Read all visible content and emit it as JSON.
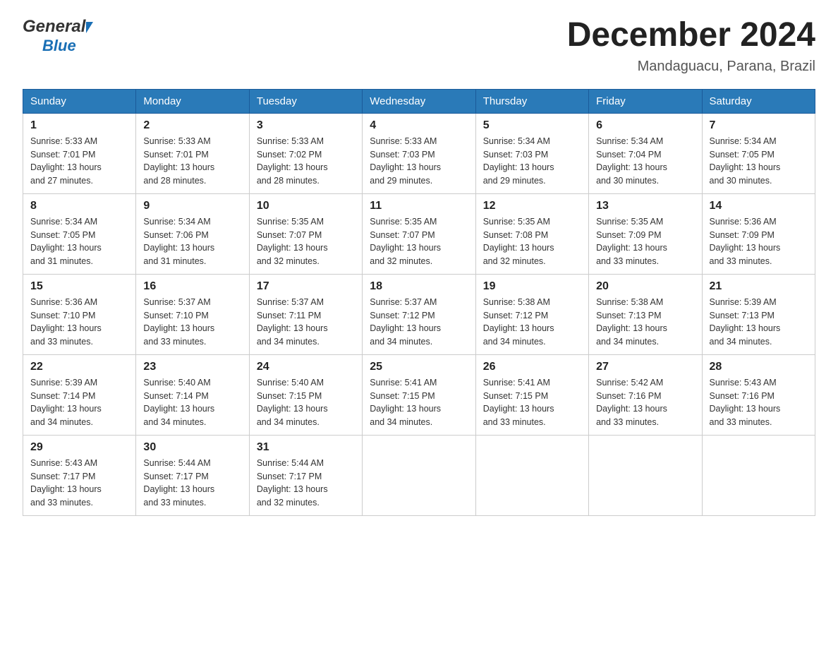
{
  "header": {
    "logo_general": "General",
    "logo_blue": "Blue",
    "month_title": "December 2024",
    "location": "Mandaguacu, Parana, Brazil"
  },
  "days_of_week": [
    "Sunday",
    "Monday",
    "Tuesday",
    "Wednesday",
    "Thursday",
    "Friday",
    "Saturday"
  ],
  "weeks": [
    [
      {
        "day": "1",
        "sunrise": "5:33 AM",
        "sunset": "7:01 PM",
        "daylight": "13 hours and 27 minutes."
      },
      {
        "day": "2",
        "sunrise": "5:33 AM",
        "sunset": "7:01 PM",
        "daylight": "13 hours and 28 minutes."
      },
      {
        "day": "3",
        "sunrise": "5:33 AM",
        "sunset": "7:02 PM",
        "daylight": "13 hours and 28 minutes."
      },
      {
        "day": "4",
        "sunrise": "5:33 AM",
        "sunset": "7:03 PM",
        "daylight": "13 hours and 29 minutes."
      },
      {
        "day": "5",
        "sunrise": "5:34 AM",
        "sunset": "7:03 PM",
        "daylight": "13 hours and 29 minutes."
      },
      {
        "day": "6",
        "sunrise": "5:34 AM",
        "sunset": "7:04 PM",
        "daylight": "13 hours and 30 minutes."
      },
      {
        "day": "7",
        "sunrise": "5:34 AM",
        "sunset": "7:05 PM",
        "daylight": "13 hours and 30 minutes."
      }
    ],
    [
      {
        "day": "8",
        "sunrise": "5:34 AM",
        "sunset": "7:05 PM",
        "daylight": "13 hours and 31 minutes."
      },
      {
        "day": "9",
        "sunrise": "5:34 AM",
        "sunset": "7:06 PM",
        "daylight": "13 hours and 31 minutes."
      },
      {
        "day": "10",
        "sunrise": "5:35 AM",
        "sunset": "7:07 PM",
        "daylight": "13 hours and 32 minutes."
      },
      {
        "day": "11",
        "sunrise": "5:35 AM",
        "sunset": "7:07 PM",
        "daylight": "13 hours and 32 minutes."
      },
      {
        "day": "12",
        "sunrise": "5:35 AM",
        "sunset": "7:08 PM",
        "daylight": "13 hours and 32 minutes."
      },
      {
        "day": "13",
        "sunrise": "5:35 AM",
        "sunset": "7:09 PM",
        "daylight": "13 hours and 33 minutes."
      },
      {
        "day": "14",
        "sunrise": "5:36 AM",
        "sunset": "7:09 PM",
        "daylight": "13 hours and 33 minutes."
      }
    ],
    [
      {
        "day": "15",
        "sunrise": "5:36 AM",
        "sunset": "7:10 PM",
        "daylight": "13 hours and 33 minutes."
      },
      {
        "day": "16",
        "sunrise": "5:37 AM",
        "sunset": "7:10 PM",
        "daylight": "13 hours and 33 minutes."
      },
      {
        "day": "17",
        "sunrise": "5:37 AM",
        "sunset": "7:11 PM",
        "daylight": "13 hours and 34 minutes."
      },
      {
        "day": "18",
        "sunrise": "5:37 AM",
        "sunset": "7:12 PM",
        "daylight": "13 hours and 34 minutes."
      },
      {
        "day": "19",
        "sunrise": "5:38 AM",
        "sunset": "7:12 PM",
        "daylight": "13 hours and 34 minutes."
      },
      {
        "day": "20",
        "sunrise": "5:38 AM",
        "sunset": "7:13 PM",
        "daylight": "13 hours and 34 minutes."
      },
      {
        "day": "21",
        "sunrise": "5:39 AM",
        "sunset": "7:13 PM",
        "daylight": "13 hours and 34 minutes."
      }
    ],
    [
      {
        "day": "22",
        "sunrise": "5:39 AM",
        "sunset": "7:14 PM",
        "daylight": "13 hours and 34 minutes."
      },
      {
        "day": "23",
        "sunrise": "5:40 AM",
        "sunset": "7:14 PM",
        "daylight": "13 hours and 34 minutes."
      },
      {
        "day": "24",
        "sunrise": "5:40 AM",
        "sunset": "7:15 PM",
        "daylight": "13 hours and 34 minutes."
      },
      {
        "day": "25",
        "sunrise": "5:41 AM",
        "sunset": "7:15 PM",
        "daylight": "13 hours and 34 minutes."
      },
      {
        "day": "26",
        "sunrise": "5:41 AM",
        "sunset": "7:15 PM",
        "daylight": "13 hours and 33 minutes."
      },
      {
        "day": "27",
        "sunrise": "5:42 AM",
        "sunset": "7:16 PM",
        "daylight": "13 hours and 33 minutes."
      },
      {
        "day": "28",
        "sunrise": "5:43 AM",
        "sunset": "7:16 PM",
        "daylight": "13 hours and 33 minutes."
      }
    ],
    [
      {
        "day": "29",
        "sunrise": "5:43 AM",
        "sunset": "7:17 PM",
        "daylight": "13 hours and 33 minutes."
      },
      {
        "day": "30",
        "sunrise": "5:44 AM",
        "sunset": "7:17 PM",
        "daylight": "13 hours and 33 minutes."
      },
      {
        "day": "31",
        "sunrise": "5:44 AM",
        "sunset": "7:17 PM",
        "daylight": "13 hours and 32 minutes."
      },
      null,
      null,
      null,
      null
    ]
  ],
  "labels": {
    "sunrise": "Sunrise:",
    "sunset": "Sunset:",
    "daylight": "Daylight:"
  }
}
